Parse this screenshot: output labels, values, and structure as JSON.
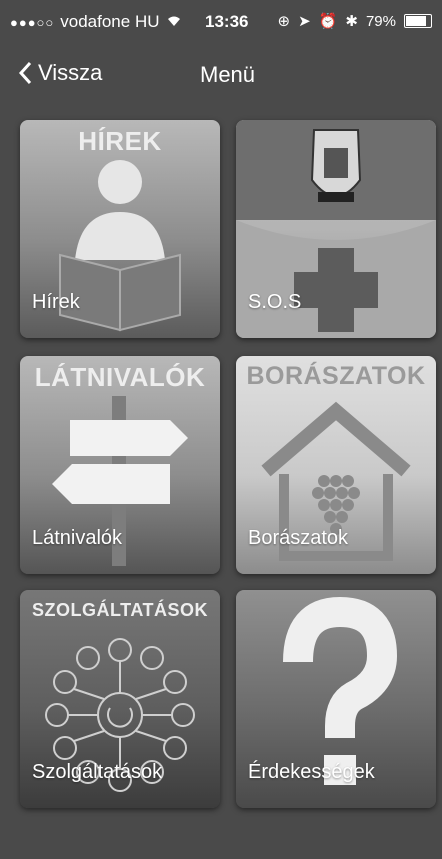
{
  "status_bar": {
    "carrier": "vodafone HU",
    "time": "13:36",
    "battery": "79%"
  },
  "nav": {
    "back_label": "Vissza",
    "title": "Menü"
  },
  "tiles": [
    {
      "header": "HÍREK",
      "label": "Hírek",
      "icon": "reader-icon"
    },
    {
      "header": "",
      "label": "S.O.S",
      "icon": "police-badge-icon"
    },
    {
      "header": "LÁTNIVALÓK",
      "label": "Látnivalók",
      "icon": "signpost-icon"
    },
    {
      "header": "BORÁSZATOK",
      "label": "Borászatok",
      "icon": "winery-house-icon"
    },
    {
      "header": "SZOLGÁLTATÁSOK",
      "label": "Szolgáltatások",
      "icon": "services-network-icon"
    },
    {
      "header": "",
      "label": "Érdekességek",
      "icon": "question-mark-icon"
    }
  ],
  "colors": {
    "background": "#4a4a4a",
    "text": "#ffffff"
  }
}
